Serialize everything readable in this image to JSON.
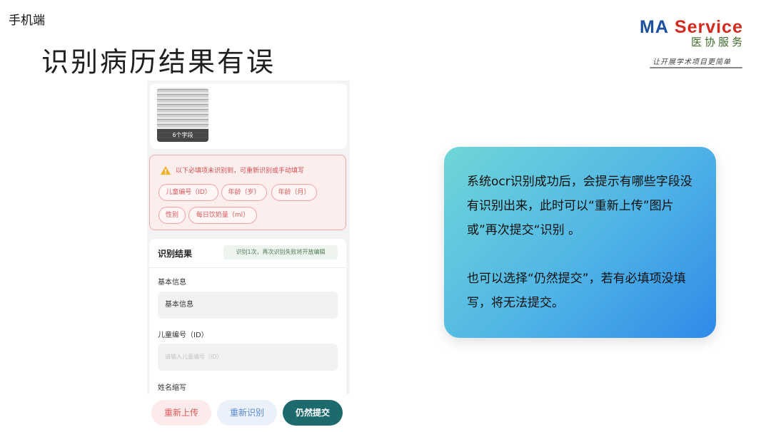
{
  "slide": {
    "label": "手机端",
    "title": "识别病历结果有误"
  },
  "logo": {
    "brand_ma": "MA",
    "brand_service": "Service",
    "brand_cn": "医协服务",
    "tagline": "让开展学术项目更简单"
  },
  "phone": {
    "image_card": {
      "caption": "6个字段"
    },
    "warning": {
      "icon": "warning-triangle-icon",
      "message": "以下必填项未识别到，可重新识别或手动填写",
      "chips": [
        "儿童编号（ID）",
        "年龄（岁）",
        "年龄（月）",
        "性别",
        "每日饮奶量（ml）"
      ]
    },
    "result": {
      "title": "识别结果",
      "badge": "识别1次，再次识别失败将开放编辑",
      "section_label": "基本信息",
      "section_value": "基本信息",
      "id_label": "儿童编号（ID）",
      "id_placeholder": "请输入儿童编号（ID）",
      "name_label": "姓名缩写"
    },
    "buttons": {
      "reupload": "重新上传",
      "rerecognize": "重新识别",
      "submit": "仍然提交"
    }
  },
  "callout": {
    "paragraph1": "系统ocr识别成功后，会提示有哪些字段没有识别出来，此时可以“重新上传”图片或”再次提交“识别 。",
    "paragraph2": "也可以选择“仍然提交”，若有必填项没填写，将无法提交。"
  }
}
